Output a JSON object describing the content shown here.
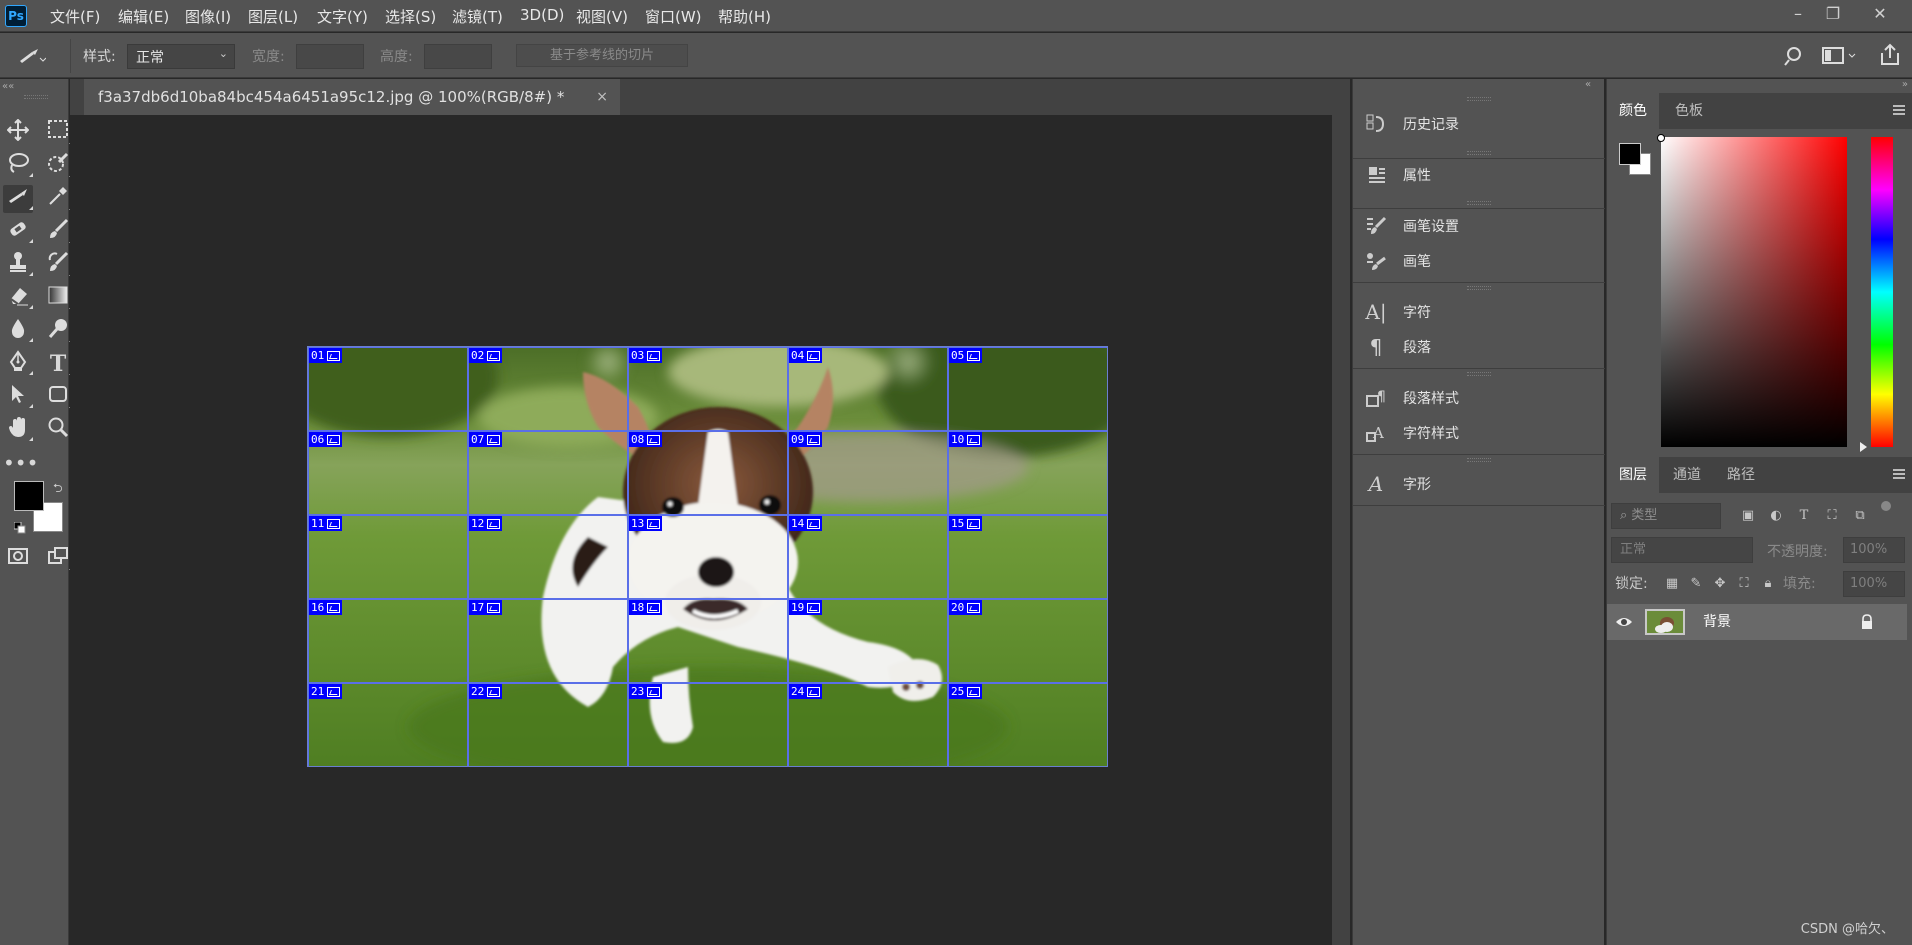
{
  "app": {
    "logo": "Ps"
  },
  "menu": [
    "文件(F)",
    "编辑(E)",
    "图像(I)",
    "图层(L)",
    "文字(Y)",
    "选择(S)",
    "滤镜(T)",
    "3D(D)",
    "视图(V)",
    "窗口(W)",
    "帮助(H)"
  ],
  "window_controls": {
    "minimize": "–",
    "restore": "❐",
    "close": "✕"
  },
  "options": {
    "style_label": "样式:",
    "style_value": "正常",
    "width_label": "宽度:",
    "height_label": "高度:",
    "guides_button": "基于参考线的切片"
  },
  "document": {
    "tab_title": "f3a37db6d10ba84bc454a6451a95c12.jpg @ 100%(RGB/8#) *",
    "close": "×",
    "slices": [
      "01",
      "02",
      "03",
      "04",
      "05",
      "06",
      "07",
      "08",
      "09",
      "10",
      "11",
      "12",
      "13",
      "14",
      "15",
      "16",
      "17",
      "18",
      "19",
      "20",
      "21",
      "22",
      "23",
      "24",
      "25"
    ]
  },
  "dock": {
    "items": [
      {
        "label": "历史记录",
        "icon": "history-icon"
      },
      {
        "label": "属性",
        "icon": "properties-icon"
      },
      {
        "label": "画笔设置",
        "icon": "brush-settings-icon"
      },
      {
        "label": "画笔",
        "icon": "brush-icon"
      },
      {
        "label": "字符",
        "icon": "character-icon"
      },
      {
        "label": "段落",
        "icon": "paragraph-icon"
      },
      {
        "label": "段落样式",
        "icon": "paragraph-styles-icon"
      },
      {
        "label": "字符样式",
        "icon": "character-styles-icon"
      },
      {
        "label": "字形",
        "icon": "glyphs-icon"
      }
    ]
  },
  "color_panel": {
    "tabs": [
      "颜色",
      "色板"
    ]
  },
  "layers_panel": {
    "tabs": [
      "图层",
      "通道",
      "路径"
    ],
    "filter_placeholder": "类型",
    "blend_mode": "正常",
    "opacity_label": "不透明度:",
    "opacity_value": "100%",
    "lock_label": "锁定:",
    "fill_label": "填充:",
    "fill_value": "100%",
    "layer_name": "背景"
  },
  "watermark": "CSDN @哈欠、"
}
